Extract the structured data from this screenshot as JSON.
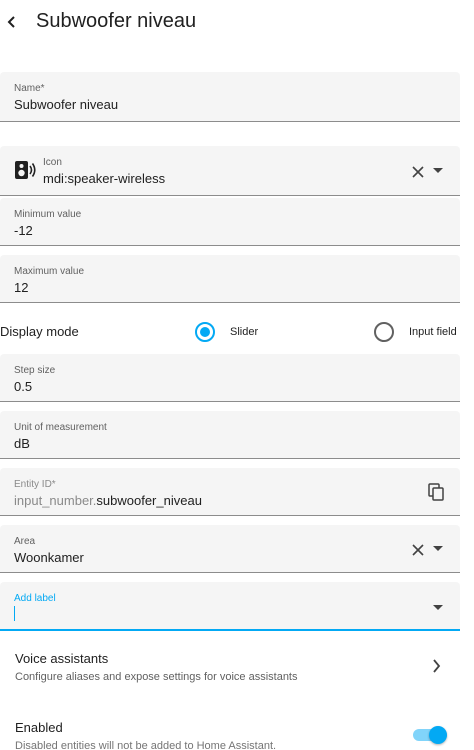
{
  "header": {
    "title": "Subwoofer niveau",
    "back_icon": "chevron-left-icon"
  },
  "name_field": {
    "label": "Name*",
    "value": "Subwoofer niveau"
  },
  "icon_field": {
    "label": "Icon",
    "value": "mdi:speaker-wireless",
    "preview_icon": "speaker-wireless-icon"
  },
  "min_field": {
    "label": "Minimum value",
    "value": "-12"
  },
  "max_field": {
    "label": "Maximum value",
    "value": "12"
  },
  "display_mode": {
    "label": "Display mode",
    "options": [
      {
        "label": "Slider",
        "selected": true
      },
      {
        "label": "Input field",
        "selected": false
      }
    ]
  },
  "step_field": {
    "label": "Step size",
    "value": "0.5"
  },
  "unit_field": {
    "label": "Unit of measurement",
    "value": "dB"
  },
  "entity_field": {
    "label": "Entity ID*",
    "prefix": "input_number.",
    "value": "subwoofer_niveau"
  },
  "area_field": {
    "label": "Area",
    "value": "Woonkamer"
  },
  "label_field": {
    "label": "Add label",
    "value": ""
  },
  "voice": {
    "title": "Voice assistants",
    "subtitle": "Configure aliases and expose settings for voice assistants"
  },
  "enabled": {
    "title": "Enabled",
    "subtitle": "Disabled entities will not be added to Home Assistant.",
    "on": true
  },
  "colors": {
    "accent": "#03a9f4",
    "field_bg": "#f5f5f5"
  }
}
